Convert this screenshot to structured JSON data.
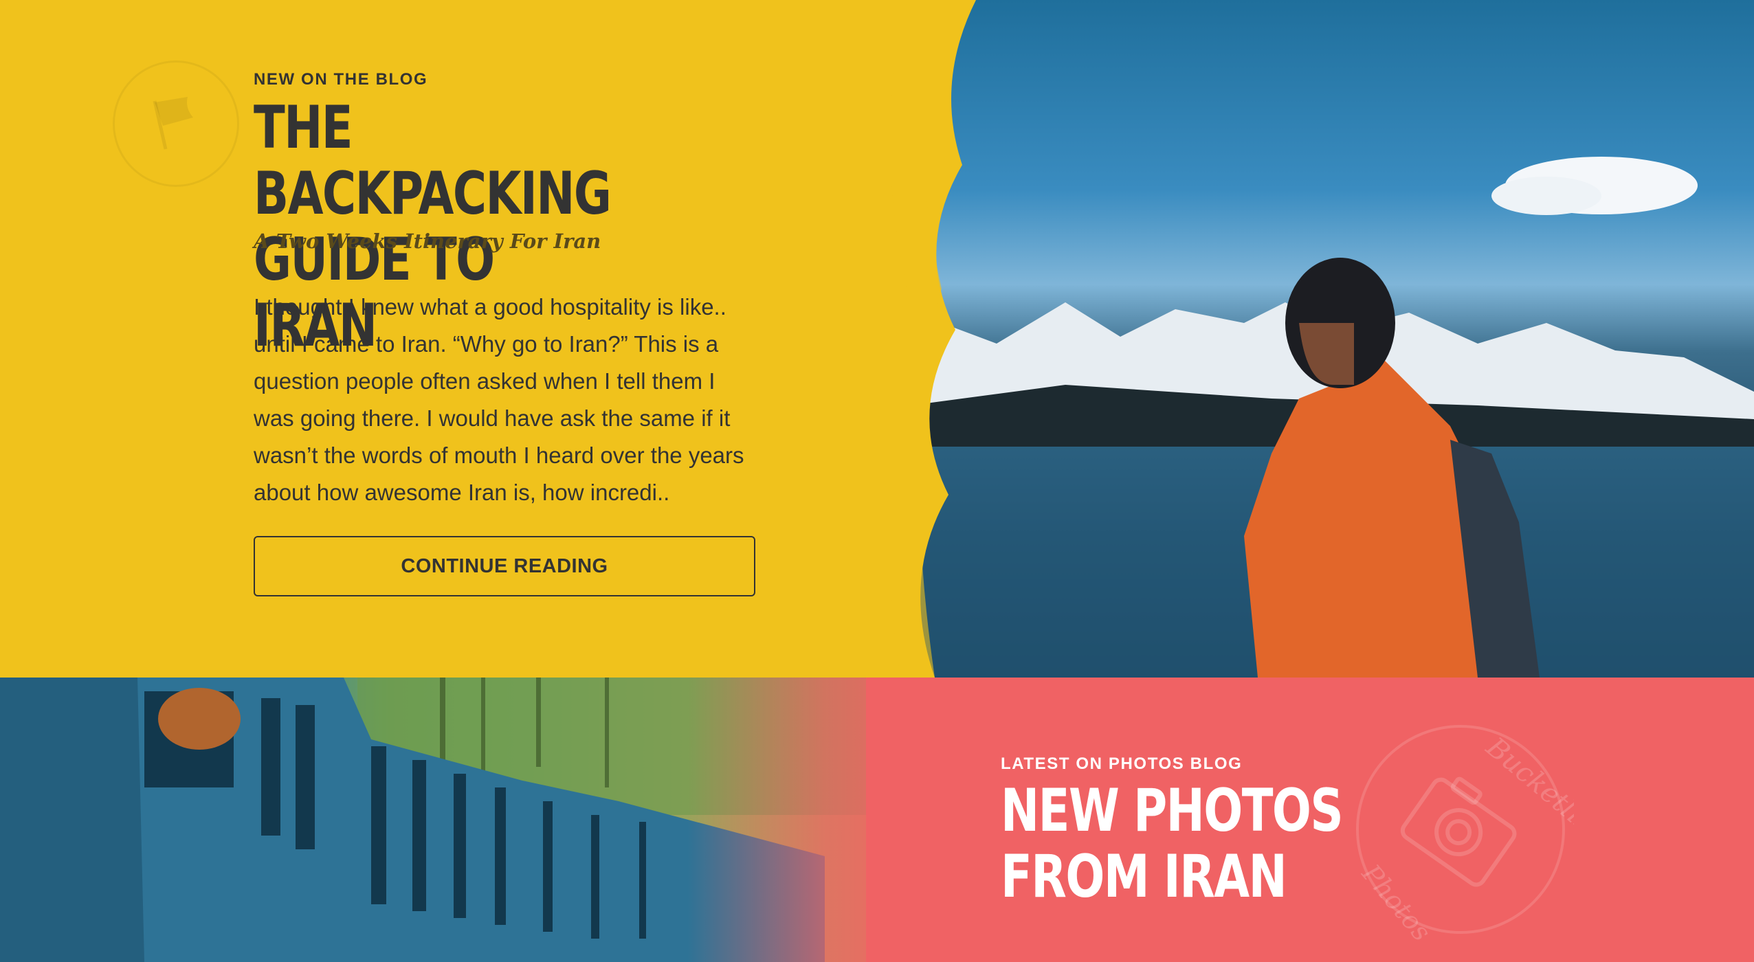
{
  "blog_section": {
    "kicker": "NEW ON THE BLOG",
    "title": "THE BACKPACKING GUIDE TO IRAN",
    "subtitle": "A Two Weeks Itinerary For Iran",
    "excerpt": "I thought I knew what a good hospitality is like.. until I came to Iran. “Why go to Iran?” This is a question people often asked when I tell them I was going there. I would have ask the same if it wasn’t the words of mouth I heard over the years about how awesome Iran is, how incredi..",
    "cta_label": "CONTINUE READING",
    "emblem_icon": "flag-icon",
    "accent_color": "#f0c21c"
  },
  "photos_section": {
    "kicker": "LATEST ON PHOTOS BLOG",
    "title": "NEW PHOTOS FROM IRAN",
    "stamp_icon": "camera-icon",
    "stamp_text_top": "Bucketlistly",
    "stamp_text_bottom": "Photos",
    "accent_color": "#f06264"
  }
}
